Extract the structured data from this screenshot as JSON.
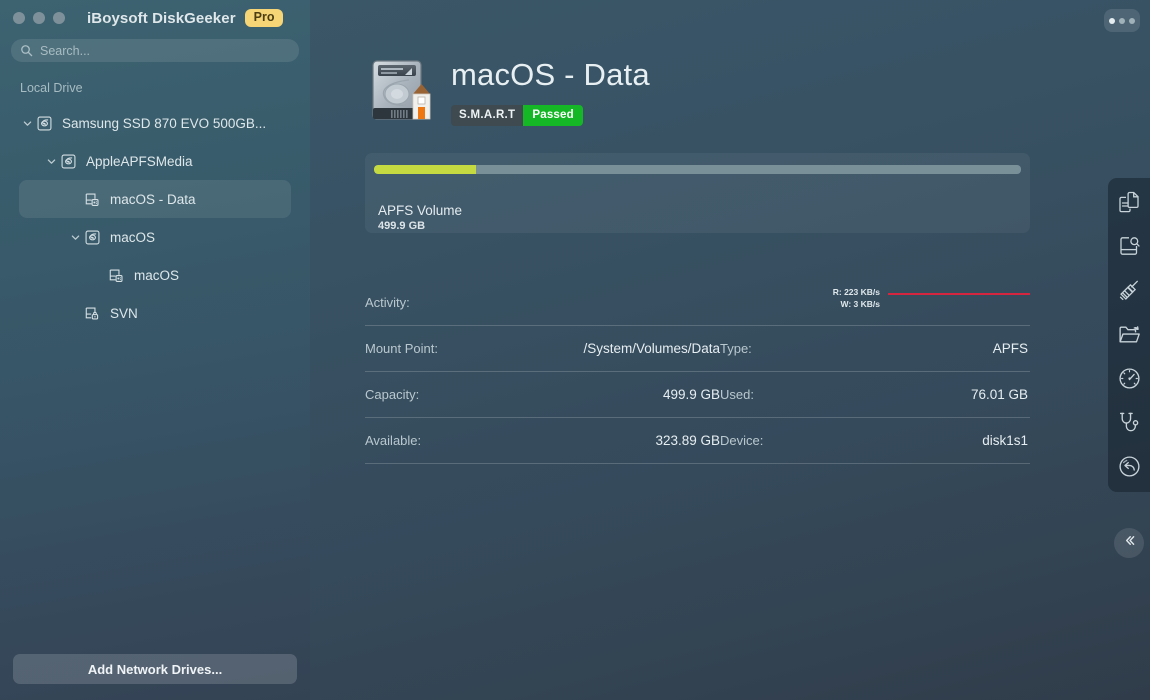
{
  "window": {
    "app_title": "iBoysoft DiskGeeker",
    "pro_badge": "Pro",
    "traffic_lights": [
      "close",
      "minimize",
      "zoom"
    ],
    "menu_icon": "more-dots-icon"
  },
  "search": {
    "placeholder": "Search...",
    "value": "",
    "icon": "search-icon"
  },
  "sidebar": {
    "section_label": "Local Drive",
    "items": [
      {
        "label": "Samsung SSD 870 EVO 500GB...",
        "icon": "disk-icon",
        "indent": 0,
        "expanded": true,
        "has_chevron": true,
        "selected": false
      },
      {
        "label": "AppleAPFSMedia",
        "icon": "disk-icon",
        "indent": 1,
        "expanded": true,
        "has_chevron": true,
        "selected": false
      },
      {
        "label": "macOS - Data",
        "icon": "volume-icon",
        "indent": 2,
        "expanded": false,
        "has_chevron": false,
        "selected": true
      },
      {
        "label": "macOS",
        "icon": "disk-icon",
        "indent": 2,
        "expanded": true,
        "has_chevron": true,
        "selected": false
      },
      {
        "label": "macOS",
        "icon": "volume-icon",
        "indent": 3,
        "expanded": false,
        "has_chevron": false,
        "selected": false
      },
      {
        "label": "SVN",
        "icon": "locked-volume-icon",
        "indent": 2,
        "expanded": false,
        "has_chevron": false,
        "selected": false
      }
    ],
    "add_network_drives_label": "Add Network Drives..."
  },
  "main": {
    "disk_icon": "hard-disk-home-icon",
    "title": "macOS - Data",
    "smart_label": "S.M.A.R.T",
    "smart_status": "Passed",
    "smart_status_color": "#15b726",
    "volume_card": {
      "name": "APFS Volume",
      "size": "499.9 GB",
      "used_percent": 15.7,
      "fill_color": "#c4da40",
      "track_color": "#7a9099"
    },
    "activity": {
      "label": "Activity:",
      "read": "R: 223 KB/s",
      "write": "W: 3 KB/s",
      "line_color": "#d6253f"
    },
    "details": [
      {
        "key": "Mount Point:",
        "value": "/System/Volumes/Data",
        "key2": "Type:",
        "value2": "APFS"
      },
      {
        "key": "Capacity:",
        "value": "499.9 GB",
        "key2": "Used:",
        "value2": "76.01 GB"
      },
      {
        "key": "Available:",
        "value": "323.89 GB",
        "key2": "Device:",
        "value2": "disk1s1"
      }
    ]
  },
  "right_toolbar": {
    "buttons": [
      {
        "icon": "clone-documents-icon",
        "name": "clone"
      },
      {
        "icon": "disk-analyze-icon",
        "name": "space-analyze"
      },
      {
        "icon": "clean-junk-broom-icon",
        "name": "clean-junk"
      },
      {
        "icon": "open-folder-icon",
        "name": "open"
      },
      {
        "icon": "speed-test-gauge-icon",
        "name": "speed-test"
      },
      {
        "icon": "stethoscope-health-icon",
        "name": "disk-health"
      },
      {
        "icon": "data-recovery-icon",
        "name": "data-recovery"
      }
    ],
    "collapse_icon": "chevron-double-left-icon"
  }
}
